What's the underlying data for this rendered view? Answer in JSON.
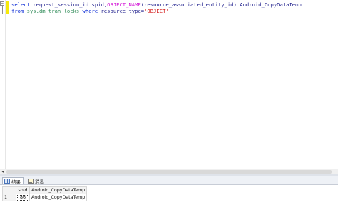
{
  "editor": {
    "fold_symbol": "−",
    "line1": {
      "kw_select": "select",
      "sp1": " request_session_id spid,",
      "fn_object_name": "OBJECT_NAME",
      "args": "(resource_associated_entity_id)",
      "alias": " Android_CopyDataTemp"
    },
    "line2": {
      "kw_from": "from",
      "sp": " ",
      "obj_name": "sys.dm_tran_locks",
      "sp2": " ",
      "kw_where": "where",
      "cond": " resource_type=",
      "str_value": "'OBJECT'"
    }
  },
  "tabs": {
    "results_label": "结果",
    "messages_label": "消息"
  },
  "results": {
    "columns": [
      "spid",
      "Android_CopyDataTemp"
    ],
    "rows": [
      {
        "rownum": "1",
        "spid": "86",
        "name": "Android_CopyDataTemp"
      }
    ]
  },
  "colors": {
    "keyword": "#0b2bd6",
    "function": "#d316d6",
    "system_object": "#2e8b57",
    "string": "#d21414",
    "change_bar": "#f6e90a"
  },
  "icons": {
    "left_arrow": "◂"
  }
}
